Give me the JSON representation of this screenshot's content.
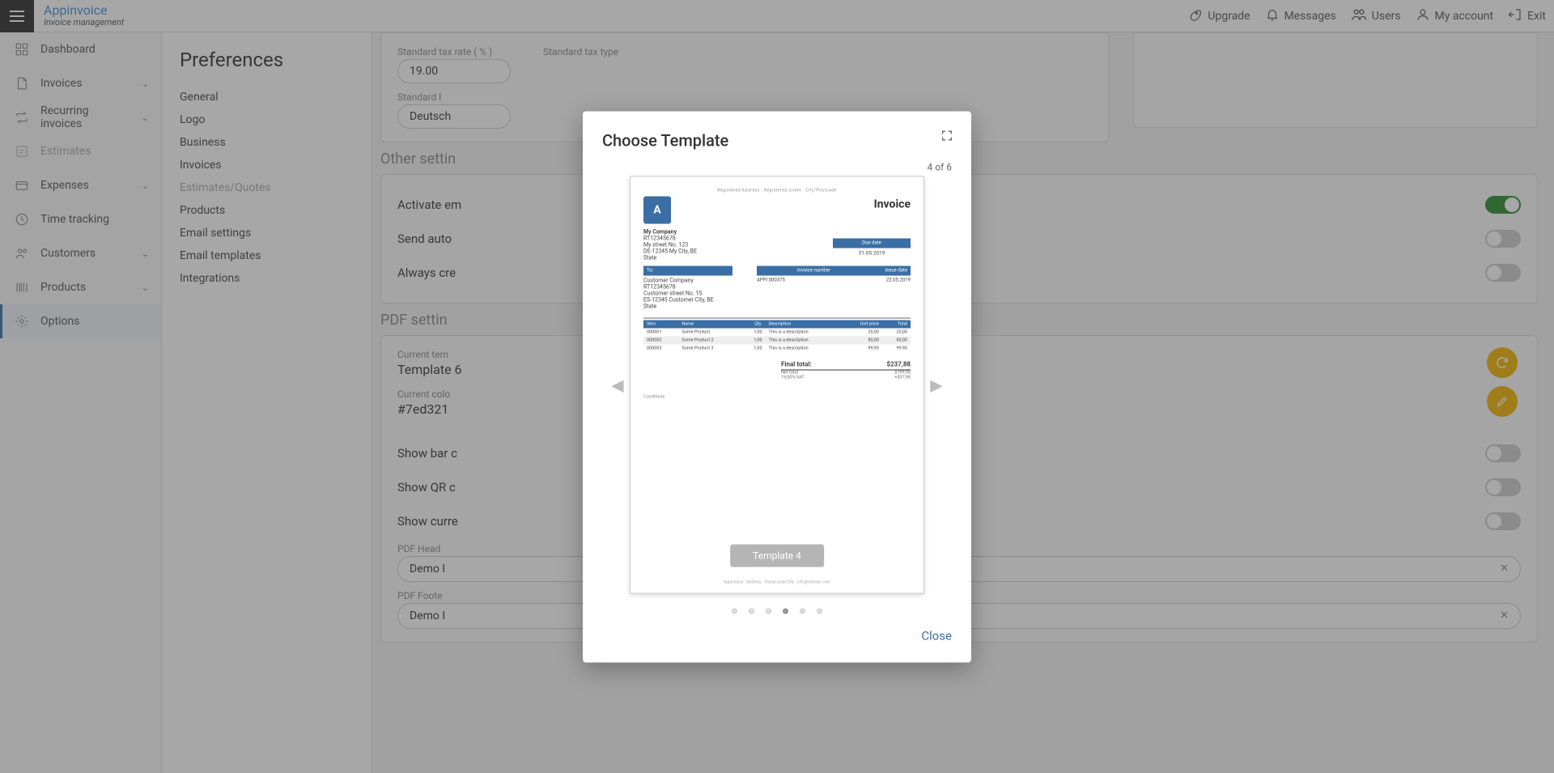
{
  "brand": {
    "title": "Appinvoice",
    "subtitle": "Invoice management"
  },
  "topbar": {
    "upgrade": "Upgrade",
    "messages": "Messages",
    "users": "Users",
    "account": "My account",
    "exit": "Exit"
  },
  "nav": {
    "dashboard": "Dashboard",
    "invoices": "Invoices",
    "recurring": "Recurring invoices",
    "estimates": "Estimates",
    "expenses": "Expenses",
    "time": "Time tracking",
    "customers": "Customers",
    "products": "Products",
    "options": "Options"
  },
  "prefs": {
    "title": "Preferences",
    "general": "General",
    "logo": "Logo",
    "business": "Business",
    "invoices": "Invoices",
    "estimates": "Estimates/Quotes",
    "products": "Products",
    "email_settings": "Email settings",
    "email_templates": "Email templates",
    "integrations": "Integrations"
  },
  "main": {
    "tax_rate_label": "Standard tax rate ( % )",
    "tax_rate_value": "19.00",
    "tax_type_label": "Standard tax type",
    "lang_label": "Standard l",
    "lang_value": "Deutsch",
    "other_title": "Other settin",
    "other_row1": "Activate em",
    "other_row2": "Send auto",
    "other_row3": "Always cre",
    "pdf_title": "PDF settin",
    "current_template_label": "Current tem",
    "current_template_value": "Template 6",
    "current_color_label": "Current colo",
    "current_color_value": "#7ed321",
    "show_bar": "Show bar c",
    "show_qr": "Show QR c",
    "show_cur": "Show curre",
    "pdf_header_label": "PDF Head",
    "pdf_header_value": "Demo I",
    "pdf_footer_label": "PDF Foote",
    "pdf_footer_value": "Demo I"
  },
  "modal": {
    "title": "Choose Template",
    "counter": "4 of 6",
    "badge": "Template 4",
    "close": "Close"
  },
  "preview": {
    "topmeta": "Registered Address : Registered street : City/Postcode",
    "doc_title": "Invoice",
    "company": "My Company",
    "vat": "RT12345678",
    "addr1": "My street No. 123",
    "addr2": "DE-12345 My City, BE",
    "addr3": "State",
    "duedate_lbl": "Due date",
    "duedate_val": "31.05.2019",
    "to_lbl": "To:",
    "inv_no_lbl": "Invoice number",
    "issue_lbl": "Issue date",
    "inv_no_val": "APPI 000375",
    "issue_val": "22.05.2019",
    "cust": "Customer Company",
    "cust_vat": "RT12345678",
    "cust_addr1": "Customer street No. 15",
    "cust_addr2": "ES-12345 Customer City, BE",
    "cust_addr3": "State",
    "th_item": "Item",
    "th_name": "Name",
    "th_qty": "Qty.",
    "th_desc": "Description",
    "th_unit": "Unit price",
    "th_total": "Total",
    "r1": [
      "000001",
      "Some Product",
      "1,00",
      "This is a description",
      "20,00",
      "20,00"
    ],
    "r2": [
      "000002",
      "Some Product 2",
      "1,00",
      "This is a description",
      "80,00",
      "80,00"
    ],
    "r3": [
      "000003",
      "Some Product 3",
      "1,00",
      "This is a description",
      "99,90",
      "99,90"
    ],
    "final_lbl": "Final total:",
    "final_val": "$237,88",
    "net_lbl": "Net total",
    "net_val": "$199,90",
    "vat2_lbl": "19,00% VAT",
    "vat2_val": "+$37,98",
    "cond": "Conditions",
    "footer": "Appinvoice · Address · Postal code/City · info@domain.com"
  }
}
